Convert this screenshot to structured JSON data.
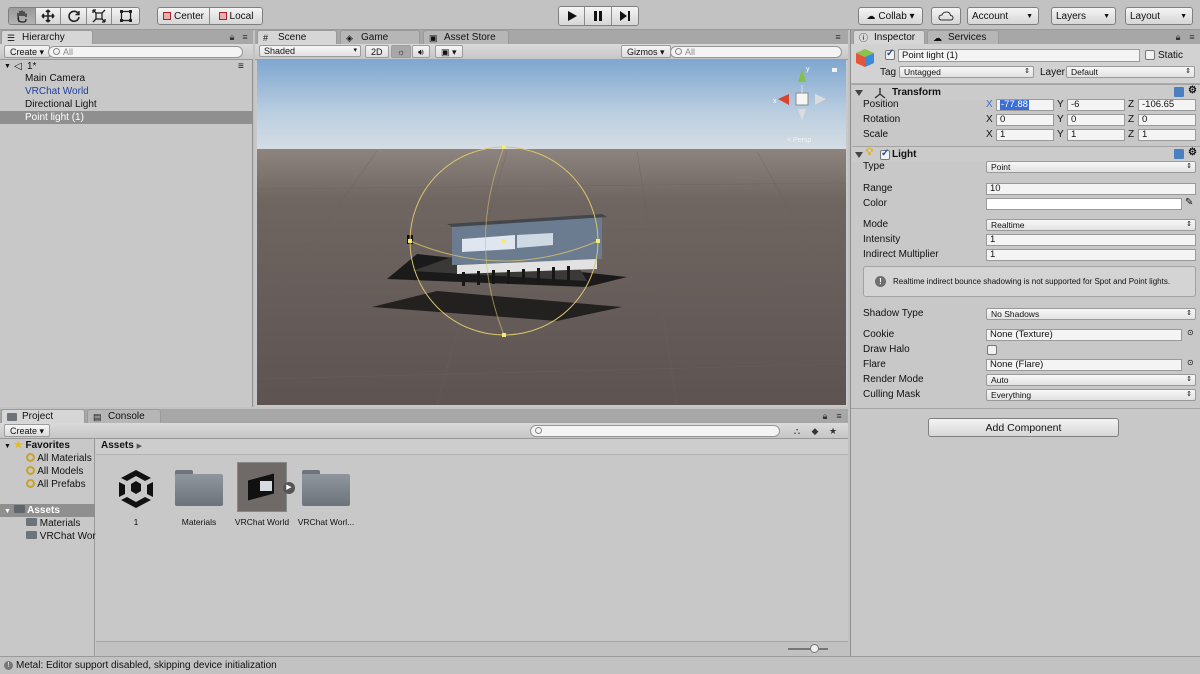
{
  "toolbar": {
    "pivot": "Center",
    "space": "Local",
    "collab": "Collab ▾",
    "account": "Account",
    "layers": "Layers",
    "layout": "Layout"
  },
  "hierarchy": {
    "tab": "Hierarchy",
    "create": "Create",
    "search_placeholder": "All",
    "scene_name": "1*",
    "items": [
      {
        "label": "Main Camera"
      },
      {
        "label": "VRChat World"
      },
      {
        "label": "Directional Light"
      },
      {
        "label": "Point light (1)"
      }
    ]
  },
  "scene": {
    "tabs": [
      "Scene",
      "Game",
      "Asset Store"
    ],
    "shading": "Shaded",
    "mode_2d": "2D",
    "gizmos": "Gizmos",
    "search_placeholder": "All",
    "gizmo_label": "< Persp"
  },
  "project": {
    "tabs": [
      "Project",
      "Console"
    ],
    "create": "Create",
    "favorites": "Favorites",
    "favorite_items": [
      "All Materials",
      "All Models",
      "All Prefabs"
    ],
    "assets_root": "Assets",
    "asset_children": [
      "Materials",
      "VRChat Worl"
    ],
    "breadcrumb": "Assets",
    "assets": [
      {
        "label": "1",
        "kind": "unity-scene"
      },
      {
        "label": "Materials",
        "kind": "folder"
      },
      {
        "label": "VRChat World",
        "kind": "prefab"
      },
      {
        "label": "VRChat Worl...",
        "kind": "folder"
      }
    ]
  },
  "inspector": {
    "tabs": [
      "Inspector",
      "Services"
    ],
    "object_name": "Point light (1)",
    "static_label": "Static",
    "tag_label": "Tag",
    "tag_value": "Untagged",
    "layer_label": "Layer",
    "layer_value": "Default",
    "transform": {
      "title": "Transform",
      "position_label": "Position",
      "rotation_label": "Rotation",
      "scale_label": "Scale",
      "position": {
        "x": "-77.88",
        "y": "-6",
        "z": "-106.65"
      },
      "rotation": {
        "x": "0",
        "y": "0",
        "z": "0"
      },
      "scale": {
        "x": "1",
        "y": "1",
        "z": "1"
      }
    },
    "light": {
      "title": "Light",
      "type_label": "Type",
      "type_value": "Point",
      "range_label": "Range",
      "range_value": "10",
      "color_label": "Color",
      "color_value": "#ffffff",
      "mode_label": "Mode",
      "mode_value": "Realtime",
      "intensity_label": "Intensity",
      "intensity_value": "1",
      "indirect_label": "Indirect Multiplier",
      "indirect_value": "1",
      "info_message": "Realtime indirect bounce shadowing is not supported for Spot and Point lights.",
      "shadow_label": "Shadow Type",
      "shadow_value": "No Shadows",
      "cookie_label": "Cookie",
      "cookie_value": "None (Texture)",
      "draw_halo_label": "Draw Halo",
      "flare_label": "Flare",
      "flare_value": "None (Flare)",
      "render_mode_label": "Render Mode",
      "render_mode_value": "Auto",
      "culling_label": "Culling Mask",
      "culling_value": "Everything"
    },
    "add_component": "Add Component",
    "xyz": {
      "x": "X",
      "y": "Y",
      "z": "Z"
    }
  },
  "status": {
    "message": "Metal: Editor support disabled, skipping device initialization"
  }
}
